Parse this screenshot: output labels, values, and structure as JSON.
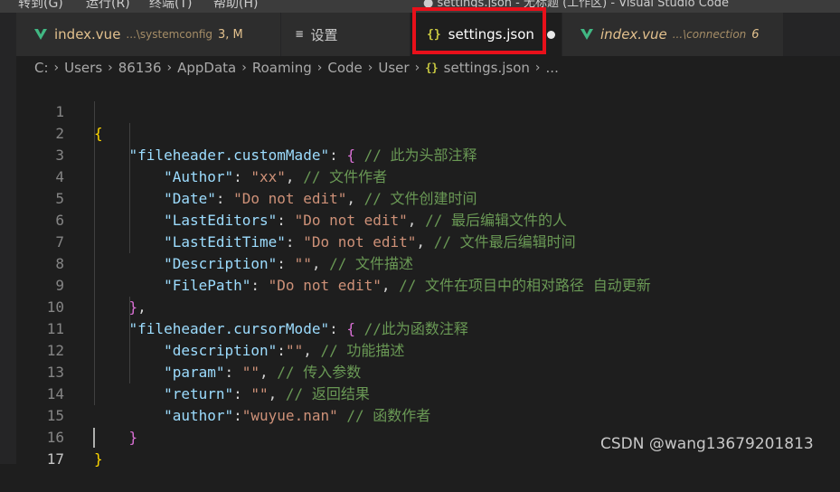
{
  "menu": {
    "items": [
      "转到(G)",
      "运行(R)",
      "终端(T)",
      "帮助(H)"
    ],
    "window_title": "● settings.json - 无标题 (工作区) - Visual Studio Code"
  },
  "tabs": [
    {
      "title": "index.vue",
      "desc": "...\\systemconfig",
      "badge": "3, M",
      "icon": "vue-icon",
      "active": false
    },
    {
      "title": "设置",
      "icon": "settings-icon",
      "icon_glyph": "≡",
      "active": false
    },
    {
      "title": "settings.json",
      "icon": "json-icon",
      "icon_glyph": "{}",
      "active": true,
      "dirty": true
    },
    {
      "title": "index.vue",
      "desc": "...\\connection",
      "badge": "6",
      "icon": "vue-icon",
      "active": false
    }
  ],
  "breadcrumb": {
    "parts": [
      "C:",
      "Users",
      "86136",
      "AppData",
      "Roaming",
      "Code",
      "User"
    ],
    "file": "settings.json",
    "file_icon": "{}",
    "tail": "..."
  },
  "editor": {
    "line_numbers": [
      "1",
      "2",
      "3",
      "4",
      "5",
      "6",
      "7",
      "8",
      "9",
      "10",
      "11",
      "12",
      "13",
      "14",
      "15",
      "16",
      "17"
    ],
    "current_line": "17"
  },
  "code": {
    "l1_open": "{",
    "l2_key": "\"fileheader.customMade\"",
    "l2_colon": ": ",
    "l2_brace": "{",
    "l2_comment": " // 此为头部注释",
    "l3_key": "\"Author\"",
    "l3_val": "\"xx\"",
    "l3_comment": "// 文件作者",
    "l4_key": "\"Date\"",
    "l4_val": "\"Do not edit\"",
    "l4_comment": "// 文件创建时间",
    "l5_key": "\"LastEditors\"",
    "l5_val": "\"Do not edit\"",
    "l5_comment": "// 最后编辑文件的人",
    "l6_key": "\"LastEditTime\"",
    "l6_val": "\"Do not edit\"",
    "l6_comment": "// 文件最后编辑时间",
    "l7_key": "\"Description\"",
    "l7_val": "\"\"",
    "l7_comment": "// 文件描述",
    "l8_key": "\"FilePath\"",
    "l8_val": "\"Do not edit\"",
    "l8_comment": "// 文件在项目中的相对路径 自动更新",
    "l9_close": "}",
    "l10_key": "\"fileheader.cursorMode\"",
    "l10_comment": " //此为函数注释",
    "l11_key": "\"description\"",
    "l11_val": "\"\"",
    "l11_comment": "// 功能描述",
    "l12_key": "\"param\"",
    "l12_val": "\"\"",
    "l12_comment": "// 传入参数",
    "l13_key": "\"return\"",
    "l13_val": "\"\"",
    "l13_comment": "// 返回结果",
    "l14_key": "\"author\"",
    "l14_val": "\"wuyue.nan\"",
    "l14_comment": "// 函数作者",
    "l15_close": "}",
    "l16_close": "}"
  },
  "watermark": "CSDN @wang13679201813",
  "colors": {
    "key": "#9cdcfe",
    "string": "#ce9178",
    "comment": "#6a9955",
    "bracket_level1": "#ffd700",
    "bracket_level2": "#da70d6",
    "modified_tab": "#e2c08d",
    "highlight_box": "#e8101a"
  }
}
